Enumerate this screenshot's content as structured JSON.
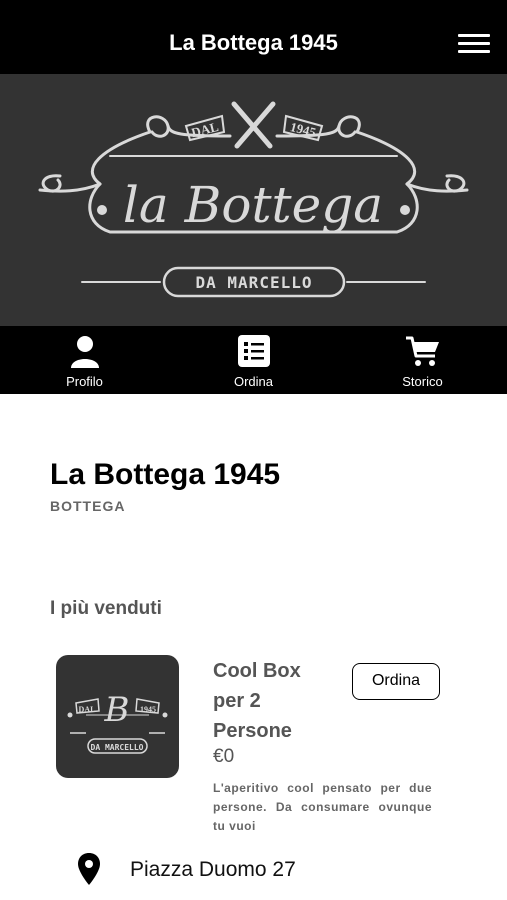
{
  "header": {
    "title": "La Bottega 1945",
    "menu_icon": "hamburger-menu-icon"
  },
  "banner": {
    "logo_dal": "DAL",
    "logo_year": "1945",
    "logo_main": "la Bottega",
    "logo_sub": "DA MARCELLO"
  },
  "nav": {
    "items": [
      {
        "label": "Profilo",
        "icon": "person-icon"
      },
      {
        "label": "Ordina",
        "icon": "list-icon"
      },
      {
        "label": "Storico",
        "icon": "cart-icon"
      }
    ]
  },
  "store": {
    "name": "La Bottega 1945",
    "type": "BOTTEGA"
  },
  "best_sellers": {
    "title": "I più venduti",
    "product": {
      "name": "Cool Box per 2 Persone",
      "price": "€0",
      "description": "L'aperitivo cool pensato per due persone. Da consumare ovunque tu vuoi",
      "order_label": "Ordina",
      "thumb_dal": "DAL",
      "thumb_letter": "B",
      "thumb_year": "1945",
      "thumb_sub": "DA MARCELLO"
    }
  },
  "address": {
    "text": "Piazza Duomo 27",
    "icon": "location-pin-icon"
  },
  "colors": {
    "bar": "#000000",
    "banner": "#333333",
    "logo": "#d9d9d9"
  }
}
